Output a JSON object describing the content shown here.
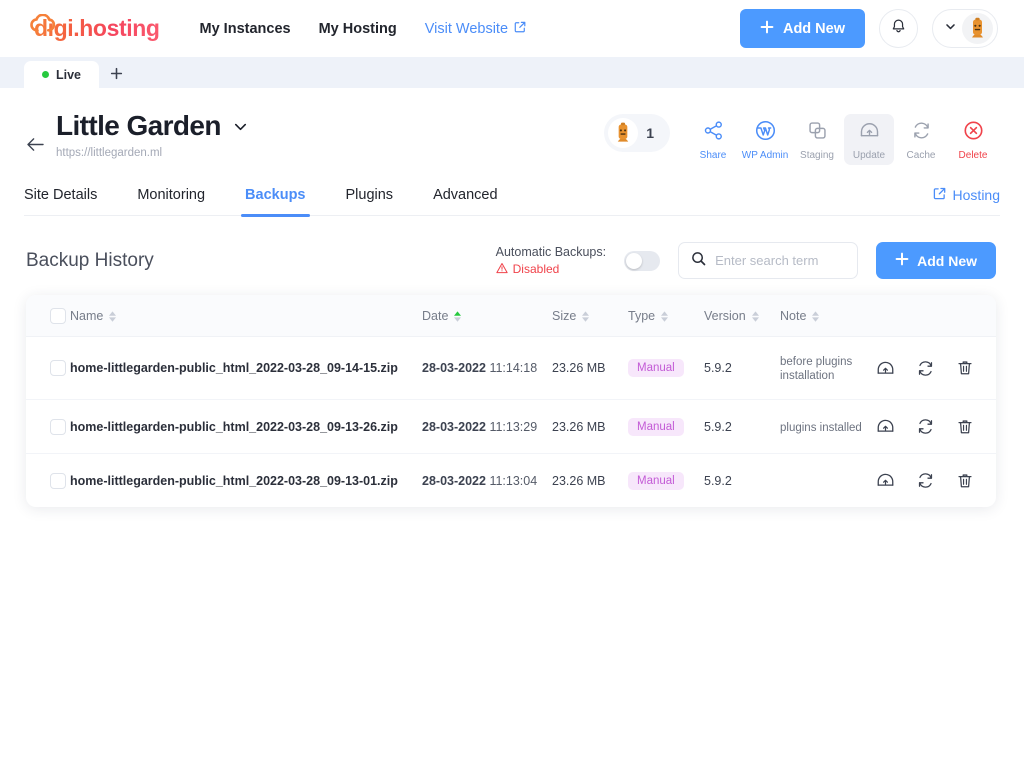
{
  "brand": {
    "name": "digi.hosting",
    "logo_icon": "cloud-icon"
  },
  "topnav": {
    "items": [
      {
        "label": "My Instances",
        "name": "nav-my-instances"
      },
      {
        "label": "My Hosting",
        "name": "nav-my-hosting"
      }
    ],
    "visit_website": "Visit Website",
    "add_new": "Add New",
    "bell_icon": "bell-icon",
    "chevron_icon": "chevron-down-icon",
    "avatar_icon": "robot-avatar"
  },
  "tabstrip": {
    "live_tab": "Live",
    "add_tab": "+"
  },
  "site": {
    "title": "Little Garden",
    "url": "https://littlegarden.ml",
    "back_icon": "arrow-left-icon",
    "title_chevron": "chevron-down-icon",
    "user_count": "1",
    "actions": [
      {
        "label": "Share",
        "name": "share",
        "icon": "share-icon",
        "tone": "blue",
        "selected": false
      },
      {
        "label": "WP Admin",
        "name": "wp-admin",
        "icon": "wordpress-icon",
        "tone": "blue",
        "selected": false
      },
      {
        "label": "Staging",
        "name": "staging",
        "icon": "copy-icon",
        "tone": "gray",
        "selected": false
      },
      {
        "label": "Update",
        "name": "update",
        "icon": "upload-arch-icon",
        "tone": "gray",
        "selected": true
      },
      {
        "label": "Cache",
        "name": "cache",
        "icon": "refresh-icon",
        "tone": "gray",
        "selected": false
      },
      {
        "label": "Delete",
        "name": "delete",
        "icon": "close-circle-icon",
        "tone": "red",
        "selected": false
      }
    ]
  },
  "navtabs": {
    "items": [
      {
        "label": "Site Details",
        "active": false
      },
      {
        "label": "Monitoring",
        "active": false
      },
      {
        "label": "Backups",
        "active": true
      },
      {
        "label": "Plugins",
        "active": false
      },
      {
        "label": "Advanced",
        "active": false
      }
    ],
    "hosting_link": "Hosting",
    "hosting_icon": "external-link-icon"
  },
  "backups": {
    "section_title": "Backup History",
    "automatic_label": "Automatic Backups:",
    "automatic_status": "Disabled",
    "automatic_enabled": false,
    "warning_icon": "warning-triangle-icon",
    "search_placeholder": "Enter search term",
    "search_value": "",
    "search_icon": "search-icon",
    "add_new": "Add New",
    "columns": [
      {
        "label": "Name",
        "sort": "none"
      },
      {
        "label": "Date",
        "sort": "asc"
      },
      {
        "label": "Size",
        "sort": "none"
      },
      {
        "label": "Type",
        "sort": "none"
      },
      {
        "label": "Version",
        "sort": "none"
      },
      {
        "label": "Note",
        "sort": "none"
      }
    ],
    "row_action_icons": [
      "restore-icon",
      "sync-icon",
      "trash-icon"
    ],
    "rows": [
      {
        "name": "home-littlegarden-public_html_2022-03-28_09-14-15.zip",
        "date": "28-03-2022",
        "time": "11:14:18",
        "size": "23.26 MB",
        "type": "Manual",
        "version": "5.9.2",
        "note": "before plugins installation"
      },
      {
        "name": "home-littlegarden-public_html_2022-03-28_09-13-26.zip",
        "date": "28-03-2022",
        "time": "11:13:29",
        "size": "23.26 MB",
        "type": "Manual",
        "version": "5.9.2",
        "note": "plugins installed"
      },
      {
        "name": "home-littlegarden-public_html_2022-03-28_09-13-01.zip",
        "date": "28-03-2022",
        "time": "11:13:04",
        "size": "23.26 MB",
        "type": "Manual",
        "version": "5.9.2",
        "note": ""
      }
    ]
  },
  "colors": {
    "accent_blue": "#4c9aff",
    "link_blue": "#4b8df8",
    "danger_red": "#f0434b",
    "badge_purple": "#c35bd6",
    "live_green": "#27c93f",
    "tabstrip_bg": "#eef2f9"
  }
}
